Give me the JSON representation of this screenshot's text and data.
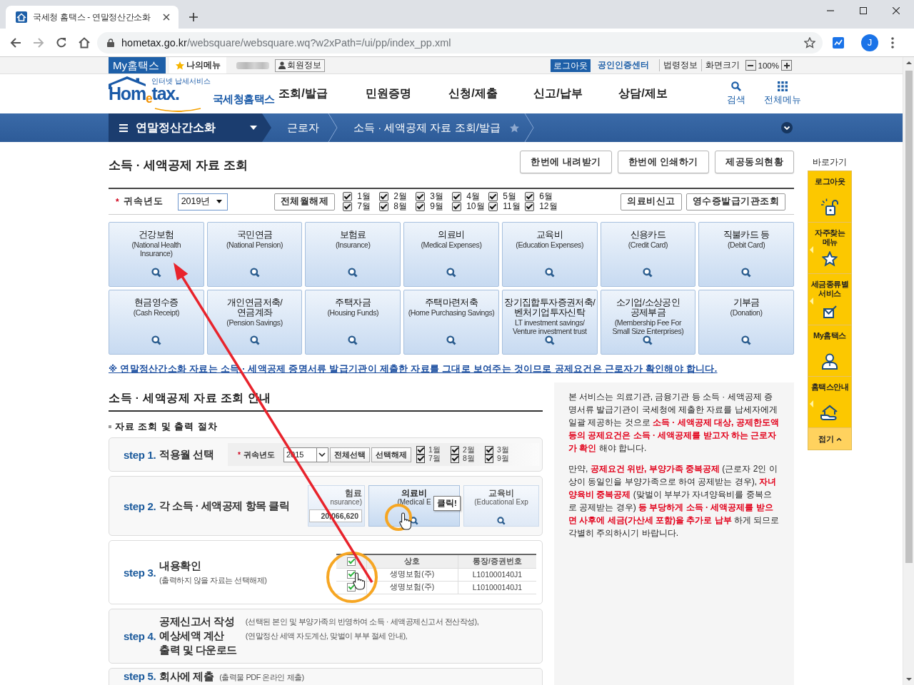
{
  "browser": {
    "tab_title": "국세청 홈택스 - 연말정산간소화",
    "url_host": "hometax.go.kr",
    "url_path": "/websquare/websquare.wq?w2xPath=/ui/pp/index_pp.xml",
    "profile_initial": "J"
  },
  "utility_bar": {
    "my_hometax": "My홈택스",
    "my_menu": "나의메뉴",
    "member_info": "회원정보",
    "logout": "로그아웃",
    "cert_center": "공인인증센터",
    "law_info": "법령정보",
    "screen_size": "화면크기",
    "zoom": "100%"
  },
  "header": {
    "logo_tagline": "인터넷 납세서비스",
    "logo_wordmark": "Hom$_{e}$tax.",
    "logo_name": "국세청홈택스",
    "menu": [
      "조회/발급",
      "민원증명",
      "신청/제출",
      "신고/납부",
      "상담/제보"
    ],
    "search": "검색",
    "all_menu": "전체메뉴"
  },
  "nav": {
    "section": "연말정산간소화",
    "breadcrumbs": [
      "근로자",
      "소득 · 세액공제 자료 조회/발급"
    ],
    "favorite": false
  },
  "page": {
    "title": "소득 · 세액공제 자료 조회",
    "actions": [
      "한번에 내려받기",
      "한번에 인쇄하기",
      "제공동의현황"
    ]
  },
  "filter": {
    "required_mark": "*",
    "year_label": "귀속년도",
    "year": "2019년",
    "clear_months": "전체월해제",
    "months": [
      {
        "label": "1월",
        "checked": true
      },
      {
        "label": "2월",
        "checked": true
      },
      {
        "label": "3월",
        "checked": true
      },
      {
        "label": "4월",
        "checked": true
      },
      {
        "label": "5월",
        "checked": true
      },
      {
        "label": "6월",
        "checked": true
      },
      {
        "label": "7월",
        "checked": true
      },
      {
        "label": "8월",
        "checked": true
      },
      {
        "label": "9월",
        "checked": true
      },
      {
        "label": "10월",
        "checked": true
      },
      {
        "label": "11월",
        "checked": true
      },
      {
        "label": "12월",
        "checked": true
      }
    ],
    "links": [
      "의료비신고",
      "영수증발급기관조회"
    ]
  },
  "tiles": [
    {
      "title": "건강보험",
      "subtitle": "(National Health\nInsurance)"
    },
    {
      "title": "국민연금",
      "subtitle": "(National Pension)"
    },
    {
      "title": "보험료",
      "subtitle": "(Insurance)"
    },
    {
      "title": "의료비",
      "subtitle": "(Medical Expenses)"
    },
    {
      "title": "교육비",
      "subtitle": "(Education Expenses)"
    },
    {
      "title": "신용카드",
      "subtitle": "(Credit Card)"
    },
    {
      "title": "직불카드 등",
      "subtitle": "(Debit Card)"
    },
    {
      "title": "현금영수증",
      "subtitle": "(Cash Receipt)"
    },
    {
      "title": "개인연금저축/\n연금계좌",
      "subtitle": "(Pension Savings)"
    },
    {
      "title": "주택자금",
      "subtitle": "(Housing Funds)"
    },
    {
      "title": "주택마련저축",
      "subtitle": "(Home Purchasing Savings)"
    },
    {
      "title": "장기집합투자증권저축/\n벤처기업투자신탁",
      "subtitle": "LT investment savings/\nVenture investment trust"
    },
    {
      "title": "소기업/소상공인\n공제부금",
      "subtitle": "(Membership Fee For\nSmall Size Enterprises)"
    },
    {
      "title": "기부금",
      "subtitle": "(Donation)"
    }
  ],
  "notice": "※ 연말정산간소화 자료는 소득 · 세액공제 증명서류 발급기관이 제출한 자료를 그대로 보여주는 것이므로 공제요건은 근로자가 확인해야 합니다.",
  "guide": {
    "title": "소득 · 세액공제 자료 조회 안내",
    "subtitle": "자료 조회 및 출력 절차",
    "steps": [
      {
        "kind": "months",
        "label": "step 1.",
        "title": "적용월 선택",
        "required_mark": "*",
        "year_label": "귀속년도",
        "year": "2015",
        "buttons": [
          "전체선택",
          "선택해제"
        ],
        "months": [
          {
            "label": "1월",
            "checked": true
          },
          {
            "label": "2월",
            "checked": true
          },
          {
            "label": "3월",
            "checked": true
          },
          {
            "label": "7월",
            "checked": true
          },
          {
            "label": "8월",
            "checked": true
          },
          {
            "label": "9월",
            "checked": true
          }
        ]
      },
      {
        "kind": "tiles",
        "label": "step 2.",
        "title": "각 소득 · 세액공제 항목 클릭",
        "tiles": [
          {
            "title": "험료",
            "subtitle": "nsurance)",
            "amount": "20,066,620",
            "dimmed": true
          },
          {
            "title": "의료비",
            "subtitle": "(Medical E",
            "callout": "클릭!",
            "dimmed": false
          },
          {
            "title": "교육비",
            "subtitle": "(Educational Exp",
            "dimmed": true
          }
        ]
      },
      {
        "kind": "table",
        "label": "step 3.",
        "title": "내용확인",
        "note": "(출력하지 않을 자료는 선택해제)",
        "header_checked": true,
        "columns": [
          "상호",
          "통장/증권번호"
        ],
        "rows": [
          {
            "checked": true,
            "cells": [
              "생명보험(주)",
              "L101000140J1"
            ]
          },
          {
            "checked": true,
            "cells": [
              "생명보험(주)",
              "L101000140J1"
            ]
          }
        ]
      },
      {
        "kind": "list",
        "label": "step 4.",
        "items": [
          {
            "title": "공제신고서 작성",
            "note": "(선택된 본인 및 부양가족의 반영하여 소득 · 세액공제신고서 전산작성),"
          },
          {
            "title": "예상세액 계산",
            "note": "(연말정산 세액 자도계산, 맞벌이 부부 절세 안내),"
          },
          {
            "title": "출력 및 다운로드"
          }
        ]
      },
      {
        "kind": "plain",
        "label": "step 5.",
        "title": "회사에 제출",
        "note": "(출력물 PDF 온라인 제출)"
      }
    ]
  },
  "info": [
    "본 서비스는 의료기관, 금융기관 등 소득 · 세액공제 증명서류 발급기관이 국세청에 제출한 자료를 납세자에게 일괄 제공하는 것으로 **소득 · 세액공제 대상, 공제한도액 등의 공제요건은 소득 · 세액공제를 받고자 하는 근로자가 확인** 해야 합니다.",
    "만약, **공제요건 위반, 부양가족 중복공제** (근로자 2인 이상이 동일인을 부양가족으로 하여 공제받는 경우), **자녀양육비 중복공제** (맞벌이 부부가 자녀양육비를 중복으로 공제받는 경우) **등 부당하게 소득 · 세액공제를 받으면 사후에 세금(가산세 포함)을 추가로 납부** 하게 되므로 각별히 주의하시기 바랍니다."
  ],
  "quick_menu": {
    "title": "바로가기",
    "items": [
      {
        "label": "로그아웃",
        "expandable": false
      },
      {
        "label": "자주찾는 메뉴",
        "expandable": true
      },
      {
        "label": "세금종류별 서비스",
        "expandable": true
      },
      {
        "label": "My홈택스",
        "expandable": false
      },
      {
        "label": "홈택스안내",
        "expandable": true
      }
    ],
    "collapse": "접기"
  }
}
